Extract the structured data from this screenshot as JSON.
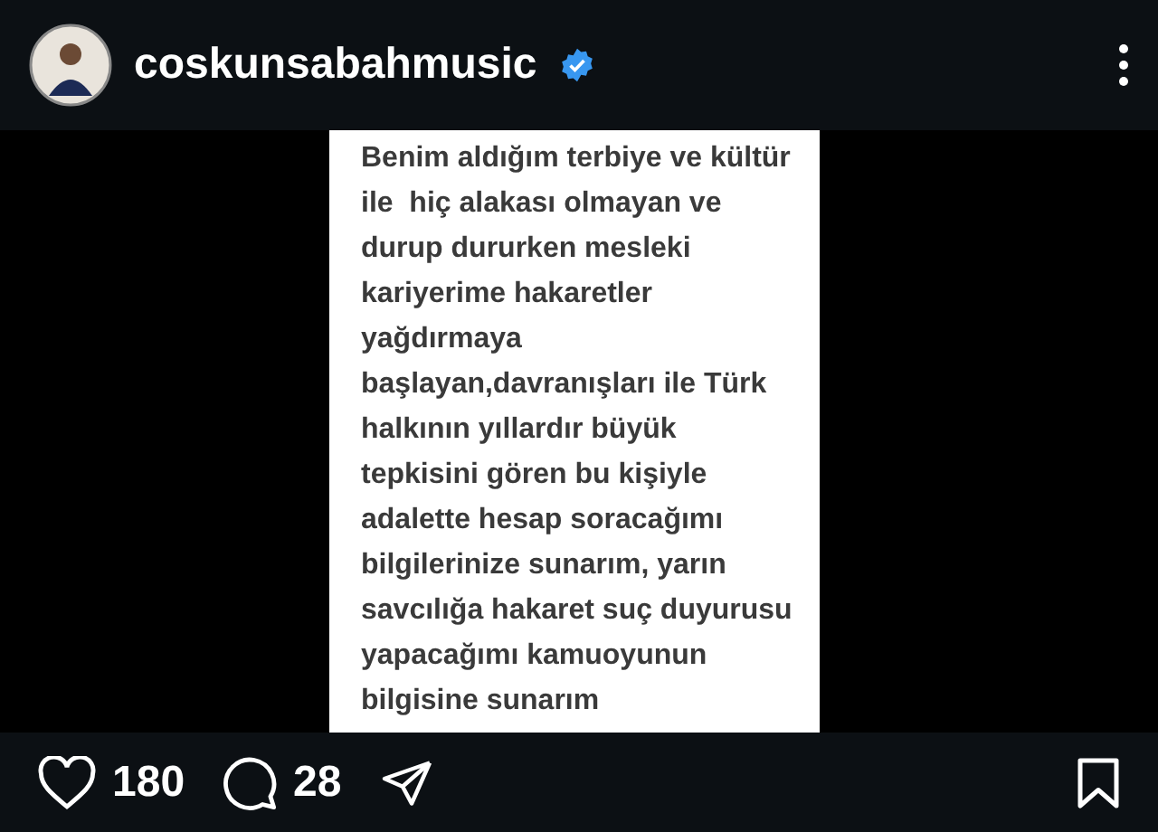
{
  "header": {
    "username": "coskunsabahmusic",
    "verified": true
  },
  "post": {
    "text": "Benim aldığım terbiye ve kültür\nile  hiç alakası olmayan ve\ndurup dururken mesleki\nkariyerime hakaretler\nyağdırmaya\nbaşlayan,davranışları ile Türk\nhalkının yıllardır büyük\ntepkisini gören bu kişiyle\nadalette hesap soracağımı\nbilgilerinize sunarım, yarın\nsavcılığa hakaret suç duyurusu\nyapacağımı kamuoyunun\nbilgisine sunarım"
  },
  "actions": {
    "likes": "180",
    "comments": "28",
    "liked": false,
    "saved": false
  }
}
